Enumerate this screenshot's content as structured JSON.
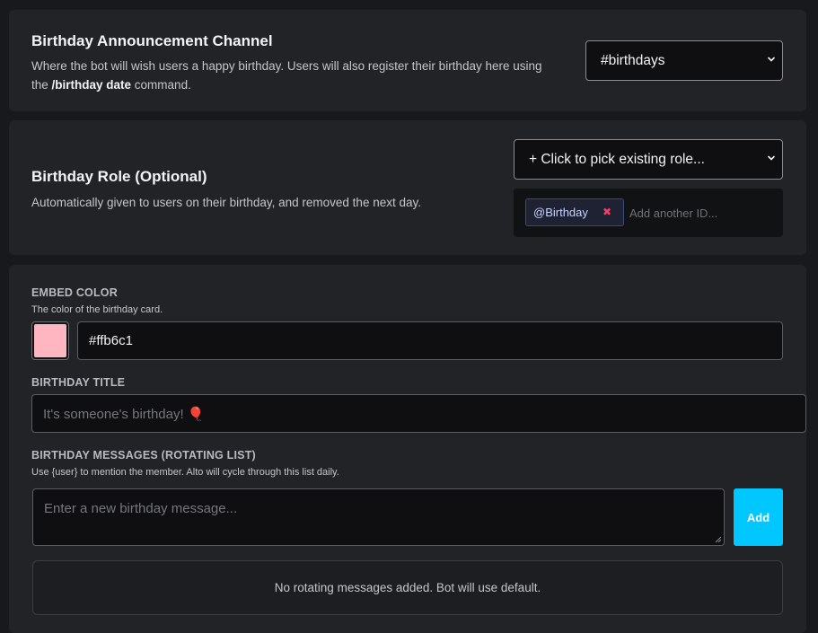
{
  "announcement": {
    "title": "Birthday Announcement Channel",
    "desc_part1": "Where the bot will wish users a happy birthday. Users will also register their birthday here using the ",
    "desc_command": "/birthday date",
    "desc_part2": " command.",
    "channel_value": "#birthdays"
  },
  "role": {
    "title": "Birthday Role (Optional)",
    "desc": "Automatically given to users on their birthday, and removed the next day.",
    "picker_label": "+ Click to pick existing role...",
    "selected_role": "@Birthday",
    "remove_glyph": "✖",
    "id_placeholder": "Add another ID..."
  },
  "embed": {
    "color_label": "EMBED COLOR",
    "color_desc": "The color of the birthday card.",
    "color_value": "#ffb6c1",
    "title_label": "BIRTHDAY TITLE",
    "title_placeholder": "It's someone's birthday! 🎈",
    "messages_label": "BIRTHDAY MESSAGES (ROTATING LIST)",
    "messages_desc": "Use {user} to mention the member. Alto will cycle through this list daily.",
    "message_placeholder": "Enter a new birthday message...",
    "add_label": "Add",
    "empty_text": "No rotating messages added. Bot will use default."
  },
  "colors": {
    "accent": "#00c8ff",
    "swatch": "#ffb6c1",
    "remove": "#f23f63"
  },
  "icons": {
    "select_chevron": "chevron-down-icon",
    "remove": "close-icon",
    "resize": "resize-grip-icon"
  }
}
